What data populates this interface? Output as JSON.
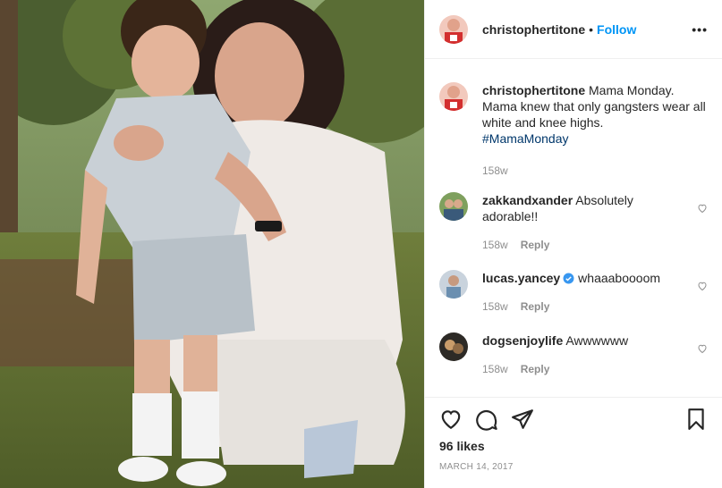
{
  "post": {
    "username": "christophertitone",
    "follow_label": "Follow",
    "dot": "•",
    "more": "•••"
  },
  "caption": {
    "username": "christophertitone",
    "text": "Mama Monday. Mama knew that only gangsters wear all white and knee highs.",
    "hashtag": "#MamaMonday",
    "time": "158w"
  },
  "comments": [
    {
      "username": "zakkandxander",
      "text": "Absolutely adorable!!",
      "time": "158w",
      "reply": "Reply",
      "verified": false
    },
    {
      "username": "lucas.yancey",
      "text": "whaaaboooom",
      "time": "158w",
      "reply": "Reply",
      "verified": true
    },
    {
      "username": "dogsenjoylife",
      "text": "Awwwwww",
      "time": "158w",
      "reply": "Reply",
      "verified": false
    }
  ],
  "actions": {
    "icons": [
      "heart-icon",
      "comment-icon",
      "share-icon",
      "bookmark-icon"
    ],
    "likes": "96 likes",
    "date": "MARCH 14, 2017"
  },
  "colors": {
    "link": "#0095f6",
    "hashtag": "#00376b",
    "muted": "#8e8e8e",
    "verified": "#3897f0"
  }
}
